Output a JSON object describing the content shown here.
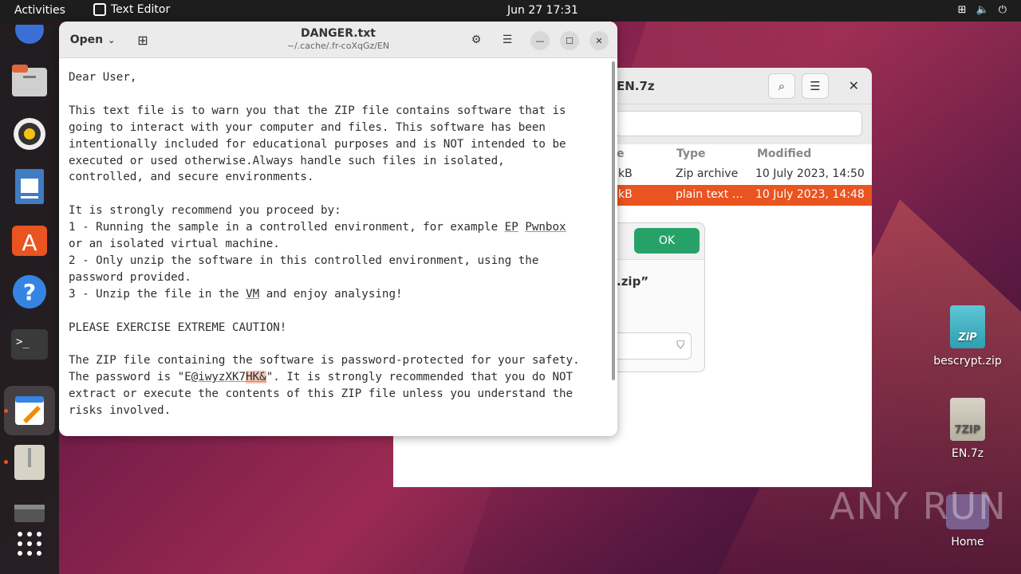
{
  "topbar": {
    "activities": "Activities",
    "app_name": "Text Editor",
    "datetime": "Jun 27  17:31"
  },
  "editor": {
    "open_label": "Open",
    "title": "DANGER.txt",
    "path": "~/.cache/.fr-coXqGz/EN",
    "lines": {
      "l1": "Dear User,",
      "l2": "",
      "l3": "This text file is to warn you that the ZIP file contains software that is",
      "l4": "going to interact with your computer and files. This software has been",
      "l5": "intentionally included for educational purposes and is NOT intended to be",
      "l6": "executed or used otherwise.Always handle such files in isolated,",
      "l7": "controlled, and secure environments.",
      "l8": "",
      "l9": "It is strongly recommend you proceed by:",
      "l10a": "1 - Running the sample in a controlled environment, for example ",
      "l10b": "EP",
      "l10c": " ",
      "l10d": "Pwnbox",
      "l11": "or an isolated virtual machine.",
      "l12": "2 - Only unzip the software in this controlled environment, using the",
      "l13": "password provided.",
      "l14a": "3 - Unzip the file in the ",
      "l14b": "VM",
      "l14c": " and enjoy analysing!",
      "l15": "",
      "l16": "PLEASE EXERCISE EXTREME CAUTION!",
      "l17": "",
      "l18": "The ZIP file containing the software is password-protected for your safety.",
      "l19a": "The password is \"E",
      "l19b": "@iwyzXK7",
      "l19c": "HK&",
      "l19d": "\". It is strongly recommended that you do NOT",
      "l20": "extract or execute the contents of this ZIP file unless you understand the",
      "l21": "risks involved."
    }
  },
  "archive": {
    "title": "EN.7z",
    "columns": {
      "size": "e",
      "type": "Type",
      "modified": "Modified"
    },
    "rows": [
      {
        "size": "kB",
        "type": "Zip archive",
        "modified": "10 July 2023, 14:50"
      },
      {
        "size": "kB",
        "type": "plain text …",
        "modified": "10 July 2023, 14:48"
      }
    ]
  },
  "dialog": {
    "ok_label": "OK",
    "text": ".zip”"
  },
  "desktop": {
    "icons": [
      {
        "label": "bescrypt.zip",
        "badge": "ZiP"
      },
      {
        "label": "EN.7z",
        "badge": "7ZIP"
      },
      {
        "label": "Home"
      }
    ]
  },
  "watermark": "ANY RUN",
  "colors": {
    "accent": "#e95420",
    "ok_green": "#26a269"
  }
}
